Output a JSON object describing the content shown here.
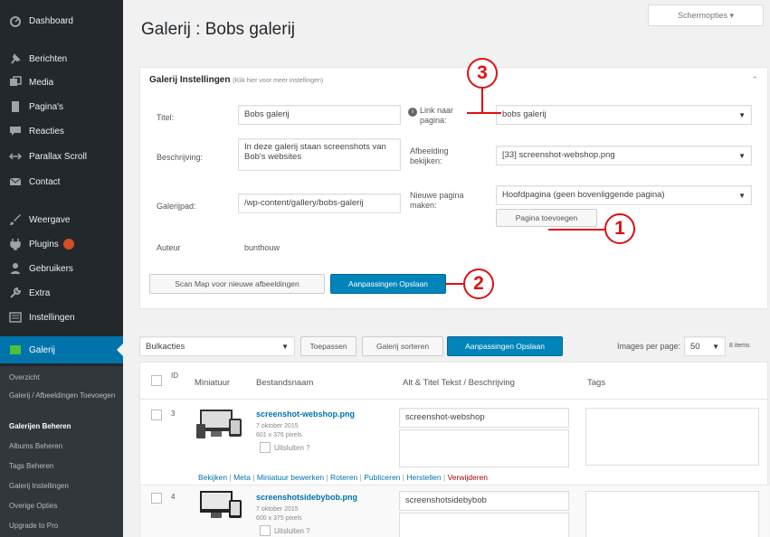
{
  "sidebar": {
    "items": [
      {
        "label": "Dashboard",
        "icon": "dashboard-icon"
      },
      {
        "label": "Berichten",
        "icon": "pin-icon"
      },
      {
        "label": "Media",
        "icon": "media-icon"
      },
      {
        "label": "Pagina's",
        "icon": "page-icon"
      },
      {
        "label": "Reacties",
        "icon": "comment-icon"
      },
      {
        "label": "Parallax Scroll",
        "icon": "scroll-icon"
      },
      {
        "label": "Contact",
        "icon": "mail-icon"
      },
      {
        "label": "Weergave",
        "icon": "brush-icon"
      },
      {
        "label": "Plugins",
        "icon": "plugin-icon"
      },
      {
        "label": "Gebruikers",
        "icon": "user-icon"
      },
      {
        "label": "Extra",
        "icon": "wrench-icon"
      },
      {
        "label": "Instellingen",
        "icon": "settings-icon"
      },
      {
        "label": "Galerij",
        "icon": "gallery-icon"
      }
    ],
    "submenu": [
      {
        "label": "Overzicht"
      },
      {
        "label": "Galerij / Afbeeldingen Toevoegen"
      },
      {
        "label": "Galerijen Beheren"
      },
      {
        "label": "Albums Beheren"
      },
      {
        "label": "Tags Beheren"
      },
      {
        "label": "Galerij Instellingen"
      },
      {
        "label": "Overige Opties"
      },
      {
        "label": "Upgrade to Pro"
      }
    ]
  },
  "header": {
    "screen_options": "Schermopties ▾",
    "title": "Galerij : Bobs galerij"
  },
  "settings": {
    "box_title": "Galerij Instellingen",
    "box_hint": "(Klik hier voor meer instellingen)",
    "title_label": "Titel:",
    "title_value": "Bobs galerij",
    "desc_label": "Beschrijving:",
    "desc_value": "In deze galerij staan screenshots van Bob's websites",
    "path_label": "Galerijpad:",
    "path_value": "/wp-content/gallery/bobs-galerij",
    "author_label": "Auteur",
    "author_value": "bunthouw",
    "link_label": "Link naar pagina:",
    "link_value": "bobs galerij",
    "preview_label": "Afbeelding bekijken:",
    "preview_value": "[33] screenshot-webshop.png",
    "newpage_label": "Nieuwe pagina maken:",
    "newpage_value": "Hoofdpagina (geen bovenliggende pagina)",
    "add_page_button": "Pagina toevoegen",
    "scan_button": "Scan Map voor nieuwe afbeeldingen",
    "save_button": "Aanpassingen Opslaan"
  },
  "callouts": [
    "1",
    "2",
    "3"
  ],
  "toolbar": {
    "bulk_value": "Bulkacties",
    "apply_button": "Toepassen",
    "sort_button": "Galerij sorteren",
    "save_button": "Aanpassingen Opslaan",
    "per_page_label": "Images per page:",
    "per_page_value": "50",
    "count_label": "8 items"
  },
  "table": {
    "headers": {
      "id": "ID",
      "thumbnail": "Miniatuur",
      "filename": "Bestandsnaam",
      "alt": "Alt & Titel Tekst / Beschrijving",
      "tags": "Tags"
    },
    "rows": [
      {
        "id": "3",
        "filename": "screenshot-webshop.png",
        "date": "7 oktober 2015",
        "size": "601 x 376 pixels",
        "exclude_label": "Uitsluiten ?",
        "alt": "screenshot-webshop"
      },
      {
        "id": "4",
        "filename": "screenshotsidebybob.png",
        "date": "7 oktober 2015",
        "size": "600 x 375 pixels",
        "exclude_label": "Uitsluiten ?",
        "alt": "screenshotsidebybob"
      }
    ],
    "row_actions": [
      "Bekijken",
      "Meta",
      "Miniatuur bewerken",
      "Roteren",
      "Publiceren",
      "Herstellen",
      "Verwijderen"
    ]
  },
  "colors": {
    "sidebar_bg": "#23282d",
    "accent": "#0073aa",
    "primary_button": "#0085ba",
    "callout": "#dd1111"
  }
}
